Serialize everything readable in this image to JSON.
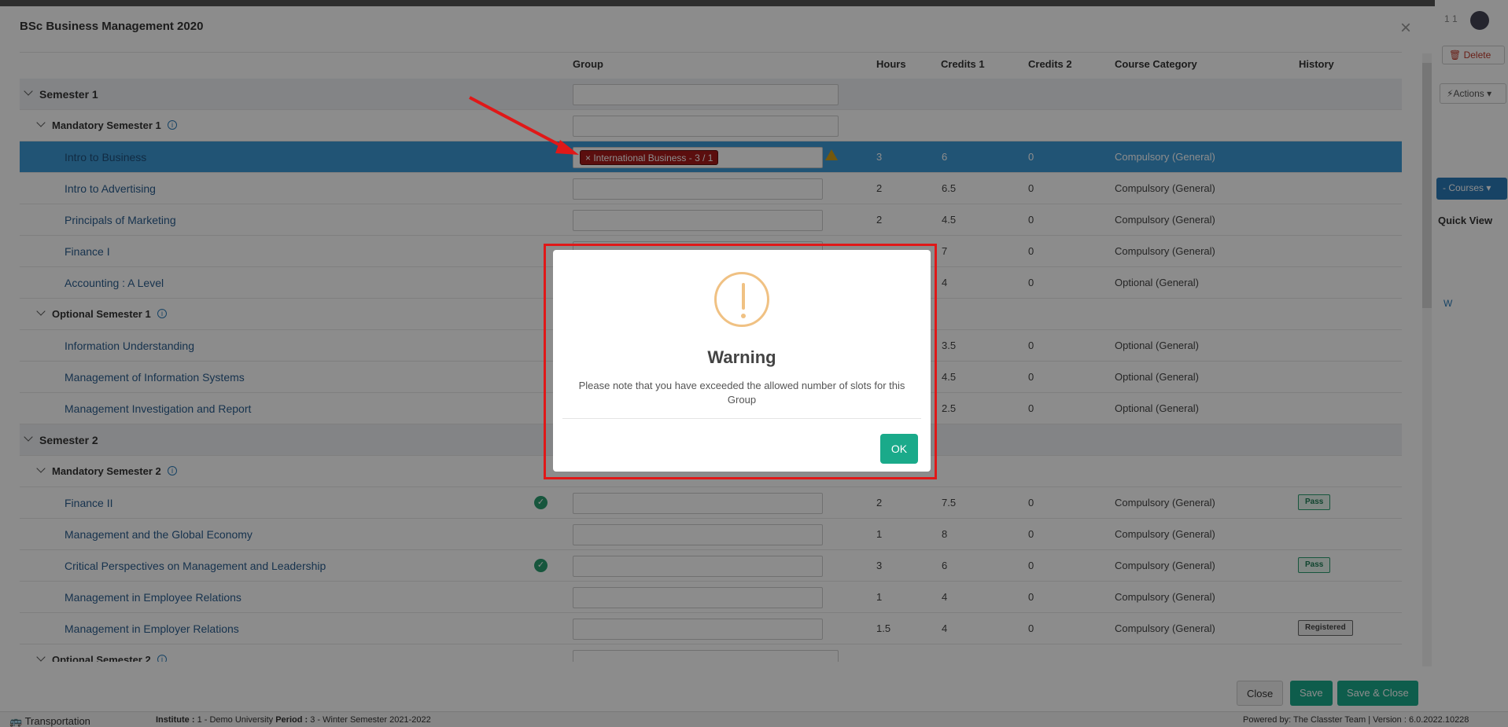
{
  "background": {
    "user": "1 1",
    "delete_label": "Delete",
    "actions_label": "Actions",
    "courses_label": "- Courses",
    "quick_view": "Quick View",
    "w_label": "W",
    "bottombar": {
      "transportation": "Transportation",
      "institute_label": "Institute :",
      "institute_value": "1 - Demo University",
      "period_label": "Period :",
      "period_value": "3 - Winter Semester 2021-2022",
      "powered": "Powered by: The Classter Team",
      "version": "| Version : 6.0.2022.10228"
    }
  },
  "modal": {
    "title": "BSc Business Management 2020",
    "columns": {
      "group": "Group",
      "hours": "Hours",
      "credits1": "Credits 1",
      "credits2": "Credits 2",
      "category": "Course Category",
      "history": "History"
    },
    "sem1": "Semester 1",
    "mand1": "Mandatory Semester 1",
    "opt1": "Optional Semester 1",
    "sem2": "Semester 2",
    "mand2": "Mandatory Semester 2",
    "opt2": "Optional Semester 2",
    "rows": [
      {
        "name": "Intro to Business",
        "hours": "3",
        "c1": "6",
        "c2": "0",
        "cat": "Compulsory (General)",
        "tag": "× International Business - 3 / 1"
      },
      {
        "name": "Intro to Advertising",
        "hours": "2",
        "c1": "6.5",
        "c2": "0",
        "cat": "Compulsory (General)"
      },
      {
        "name": "Principals of Marketing",
        "hours": "2",
        "c1": "4.5",
        "c2": "0",
        "cat": "Compulsory (General)"
      },
      {
        "name": "Finance I",
        "hours": "",
        "c1": "7",
        "c2": "0",
        "cat": "Compulsory (General)"
      },
      {
        "name": "Accounting : A Level",
        "hours": "",
        "c1": "4",
        "c2": "0",
        "cat": "Optional (General)"
      },
      {
        "name": "Information Understanding",
        "hours": "",
        "c1": "3.5",
        "c2": "0",
        "cat": "Optional (General)"
      },
      {
        "name": "Management of Information Systems",
        "hours": "",
        "c1": "4.5",
        "c2": "0",
        "cat": "Optional (General)"
      },
      {
        "name": "Management Investigation and Report",
        "hours": "",
        "c1": "2.5",
        "c2": "0",
        "cat": "Optional (General)"
      },
      {
        "name": "Finance II",
        "hours": "2",
        "c1": "7.5",
        "c2": "0",
        "cat": "Compulsory (General)",
        "history": "Pass"
      },
      {
        "name": "Management and the Global Economy",
        "hours": "1",
        "c1": "8",
        "c2": "0",
        "cat": "Compulsory (General)"
      },
      {
        "name": "Critical Perspectives on Management and Leadership",
        "hours": "3",
        "c1": "6",
        "c2": "0",
        "cat": "Compulsory (General)",
        "history": "Pass"
      },
      {
        "name": "Management in Employee Relations",
        "hours": "1",
        "c1": "4",
        "c2": "0",
        "cat": "Compulsory (General)"
      },
      {
        "name": "Management in Employer Relations",
        "hours": "1.5",
        "c1": "4",
        "c2": "0",
        "cat": "Compulsory (General)",
        "history": "Registered"
      }
    ],
    "footer": {
      "close": "Close",
      "save": "Save",
      "save_close": "Save & Close"
    }
  },
  "warning": {
    "title": "Warning",
    "message": "Please note that you have exceeded the allowed number of slots for this Group",
    "ok": "OK"
  },
  "colors": {
    "accent": "#1aaa8a",
    "selected_row": "#3d9ad6",
    "tag": "#a61b1b",
    "annotation": "#e01818",
    "warning_icon": "#f0c183"
  }
}
